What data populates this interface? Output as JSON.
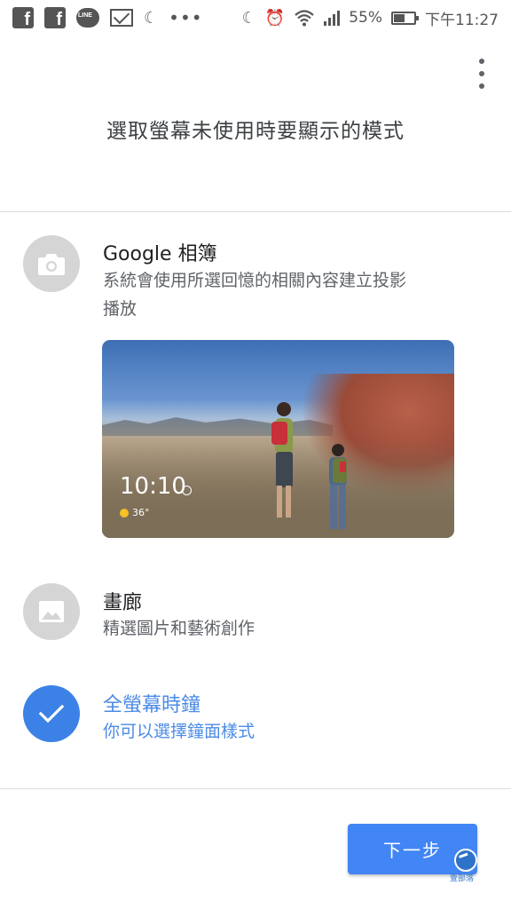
{
  "status_bar": {
    "icons": [
      "facebook-icon",
      "facebook-icon",
      "line-icon",
      "gmail-icon",
      "moon-alarm-icon",
      "more-dots-icon",
      "moon-alarm-icon",
      "alarm-icon",
      "wifi-icon",
      "signal-icon",
      "battery-icon"
    ],
    "line_label": "LINE",
    "battery": "55%",
    "time": "下午11:27"
  },
  "header": {
    "title": "選取螢幕未使用時要顯示的模式"
  },
  "options": [
    {
      "title": "Google 相簿",
      "desc": "系統會使用所選回憶的相關內容建立投影播放",
      "icon": "camera-icon",
      "selected": false
    },
    {
      "title": "畫廊",
      "desc": "精選圖片和藝術創作",
      "icon": "image-icon",
      "selected": false
    },
    {
      "title": "全螢幕時鐘",
      "desc": "你可以選擇鐘面樣式",
      "icon": "check-icon",
      "selected": true
    }
  ],
  "preview": {
    "time": "10:10",
    "temperature": "36°"
  },
  "footer": {
    "next_label": "下一步",
    "watermark": "壹部落"
  },
  "colors": {
    "accent": "#4285f4",
    "selected_circle": "#3c82e6",
    "unselected_circle": "#d5d5d5"
  }
}
